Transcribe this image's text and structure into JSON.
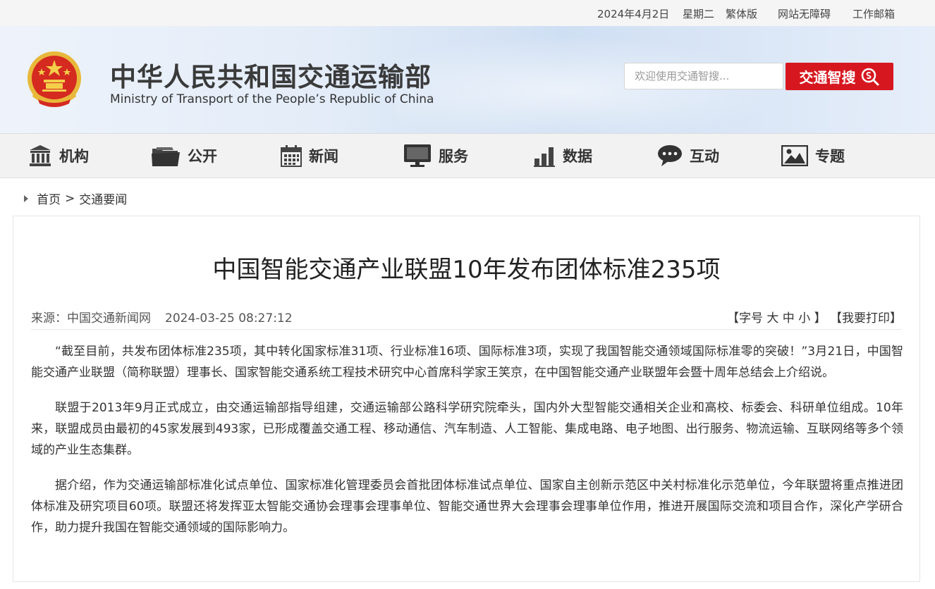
{
  "topbar": {
    "date": "2024年4月2日",
    "weekday": "星期二",
    "traditional": "繁体版",
    "accessibility": "网站无障碍",
    "mail": "工作邮箱"
  },
  "header": {
    "title": "中华人民共和国交通运输部",
    "subtitle": "Ministry of Transport of the People’s Republic of China",
    "search_placeholder": "欢迎使用交通智搜...",
    "search_button": "交通智搜"
  },
  "nav": {
    "items": [
      {
        "label": "机构",
        "icon": "building-icon"
      },
      {
        "label": "公开",
        "icon": "folder-icon"
      },
      {
        "label": "新闻",
        "icon": "calendar-icon"
      },
      {
        "label": "服务",
        "icon": "monitor-icon"
      },
      {
        "label": "数据",
        "icon": "bar-chart-icon"
      },
      {
        "label": "互动",
        "icon": "chat-icon"
      },
      {
        "label": "专题",
        "icon": "image-icon"
      }
    ]
  },
  "breadcrumb": {
    "home": "首页",
    "separator": ">",
    "section": "交通要闻"
  },
  "article": {
    "title": "中国智能交通产业联盟10年发布团体标准235项",
    "source": "来源：中国交通新闻网",
    "datetime": "2024-03-25 08:27:12",
    "font_size_label": "【字号",
    "font_large": "大",
    "font_medium": "中",
    "font_small": "小",
    "font_close": "】",
    "print": "【我要打印】",
    "paragraphs": [
      "“截至目前，共发布团体标准235项，其中转化国家标准31项、行业标准16项、国际标准3项，实现了我国智能交通领域国际标准零的突破！”3月21日，中国智能交通产业联盟（简称联盟）理事长、国家智能交通系统工程技术研究中心首席科学家王笑京，在中国智能交通产业联盟年会暨十周年总结会上介绍说。",
      "联盟于2013年9月正式成立，由交通运输部指导组建，交通运输部公路科学研究院牵头，国内外大型智能交通相关企业和高校、标委会、科研单位组成。10年来，联盟成员由最初的45家发展到493家，已形成覆盖交通工程、移动通信、汽车制造、人工智能、集成电路、电子地图、出行服务、物流运输、互联网络等多个领域的产业生态集群。",
      "据介绍，作为交通运输部标准化试点单位、国家标准化管理委员会首批团体标准试点单位、国家自主创新示范区中关村标准化示范单位，今年联盟将重点推进团体标准及研究项目60项。联盟还将发挥亚太智能交通协会理事会理事单位、智能交通世界大会理事会理事单位作用，推进开展国际交流和项目合作，深化产学研合作，助力提升我国在智能交通领域的国际影响力。"
    ]
  },
  "colors": {
    "accent_red": "#d7171f",
    "nav_bg": "#f2f2f2",
    "topbar_bg": "#f5f5f5"
  }
}
